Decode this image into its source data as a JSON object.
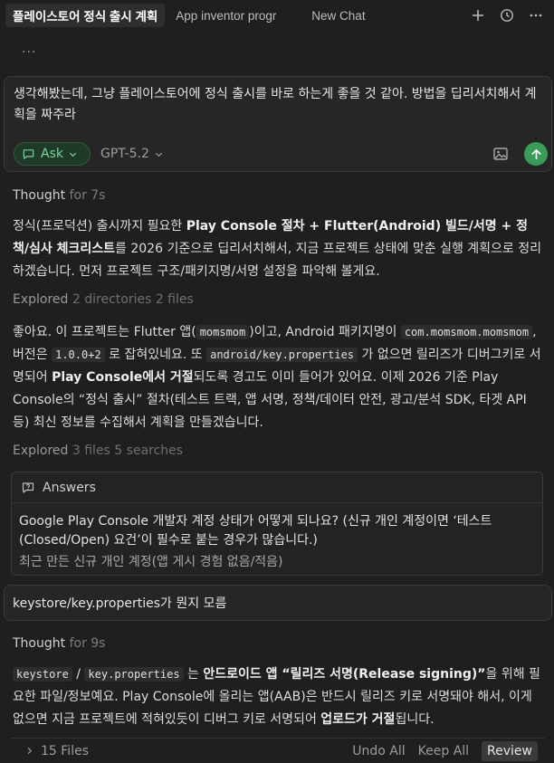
{
  "tabs": [
    {
      "label": "플레이스토어 정식 출시 계획",
      "active": true
    },
    {
      "label": "App inventor progr",
      "active": false
    },
    {
      "label": "New Chat",
      "active": false
    }
  ],
  "tab_actions": {
    "new": "plus-icon",
    "history": "clock-icon",
    "more": "more-icon"
  },
  "ellipsis": "···",
  "prompt": {
    "text": "생각해봤는데, 그냥 플레이스토어에 정식 출시를 바로 하는게 좋을 것 같아. 방법을 딥리서치해서 계획을 짜주라",
    "mode_label": "Ask",
    "model_label": "GPT-5.2"
  },
  "thought1": {
    "label": "Thought",
    "duration": "for 7s"
  },
  "para1": {
    "t1": "정식(프로덕션) 출시까지 필요한 ",
    "b1": "Play Console 절차 + Flutter(Android) 빌드/서명 + 정책/심사 체크리스트",
    "t2": "를 2026 기준으로 딥리서치해서, 지금 프로젝트 상태에 맞춘 실행 계획으로 정리하겠습니다. 먼저 프로젝트 구조/패키지명/서명 설정을 파악해 볼게요."
  },
  "explored1": {
    "label": "Explored",
    "detail": "2 directories 2 files"
  },
  "para2": {
    "t1": "좋아요. 이 프로젝트는 Flutter 앱(",
    "c1": "momsmom",
    "t2": ")이고, Android 패키지명이 ",
    "c2": "com.momsmom.momsmom",
    "t3": ", 버전은 ",
    "c3": "1.0.0+2",
    "t4": " 로 잡혀있네요. 또 ",
    "c4": "android/key.properties",
    "t5": " 가 없으면 릴리즈가 디버그키로 서명되어 ",
    "b1": "Play Console에서 거절",
    "t6": "되도록 경고도 이미 들어가 있어요. 이제 2026 기준 Play Console의 “정식 출시” 절차(테스트 트랙, 앱 서명, 정책/데이터 안전, 광고/분석 SDK, 타겟 API 등) 최신 정보를 수집해서 계획을 만들겠습니다."
  },
  "explored2": {
    "label": "Explored",
    "detail": "3 files 5 searches"
  },
  "answers": {
    "title": "Answers",
    "question": "Google Play Console 개발자 계정 상태가 어떻게 되나요? (신규 개인 계정이면 ‘테스트(Closed/Open) 요건’이 필수로 붙는 경우가 많습니다.)",
    "answer": "최근 만든 신규 개인 계정(앱 게시 경험 없음/적음)"
  },
  "user_msg": "keystore/key.properties가 뭔지 모름",
  "thought2": {
    "label": "Thought",
    "duration": "for 9s"
  },
  "para3": {
    "c1": "keystore",
    "t1": " / ",
    "c2": "key.properties",
    "t2": " 는 ",
    "b1": "안드로이드 앱 “릴리즈 서명(Release signing)”",
    "t3": "을 위해 필요한 파일/정보예요. Play Console에 올리는 앱(AAB)은 반드시 릴리즈 키로 서명돼야 해서, 이게 없으면 지금 프로젝트에 적혀있듯이 디버그 키로 서명되어 ",
    "b2": "업로드가 거절",
    "t4": "됩니다."
  },
  "bottom": {
    "files": "15 Files",
    "undo_all": "Undo All",
    "keep_all": "Keep All",
    "review": "Review"
  },
  "colors": {
    "accent": "#3a9c58",
    "background": "#1f1f1f"
  }
}
